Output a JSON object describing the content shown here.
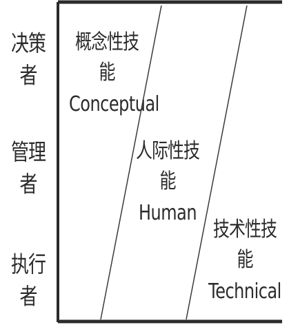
{
  "levels": [
    {
      "label": "决策者"
    },
    {
      "label": "管理者"
    },
    {
      "label": "执行者"
    }
  ],
  "skills": [
    {
      "cn": "概念性技能",
      "en": "Conceptual"
    },
    {
      "cn": "人际性技能",
      "en": "Human"
    },
    {
      "cn": "技术性技能",
      "en": "Technical"
    }
  ],
  "colors": {
    "stroke": "#2b2b2b",
    "background": "#ffffff"
  }
}
